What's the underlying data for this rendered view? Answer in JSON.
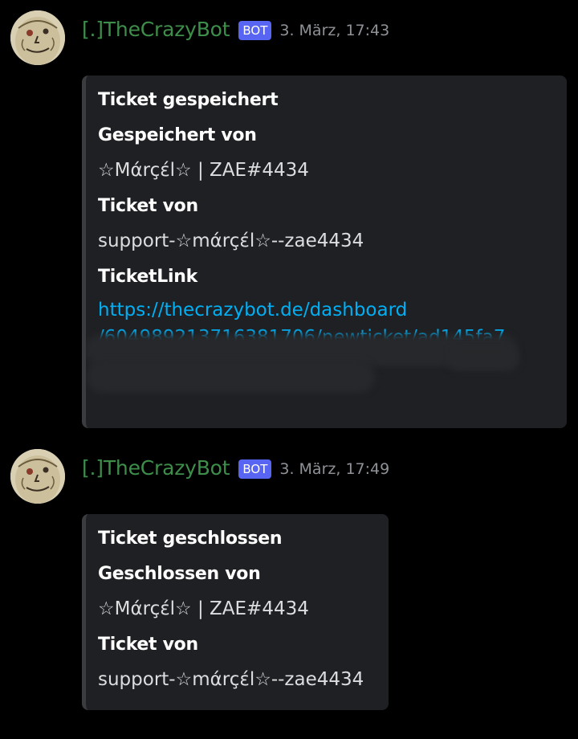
{
  "messages": [
    {
      "author": "[.]TheCrazyBot",
      "badge": "BOT",
      "timestamp": "3. März, 17:43",
      "embed": {
        "title": "Ticket gespeichert",
        "fields": [
          {
            "name": "Gespeichert von",
            "value": "☆Mάrçέl☆ | ZAE#4434"
          },
          {
            "name": "Ticket von",
            "value": "support-☆mάrçέl☆--zae4434"
          },
          {
            "name": "TicketLink",
            "value_lines": [
              "https://thecrazybot.de/dashboard",
              "/604989213716381706/newticket/ad145fa7"
            ]
          }
        ]
      }
    },
    {
      "author": "[.]TheCrazyBot",
      "badge": "BOT",
      "timestamp": "3. März, 17:49",
      "embed": {
        "title": "Ticket geschlossen",
        "fields": [
          {
            "name": "Geschlossen von",
            "value": "☆Mάrçέl☆ | ZAE#4434"
          },
          {
            "name": "Ticket von",
            "value": "support-☆mάrçέl☆--zae4434"
          }
        ]
      }
    }
  ],
  "colors": {
    "background": "#000000",
    "username": "#3e8e4b",
    "bot_badge": "#5865f2",
    "embed_bg": "#1f2023",
    "link": "#00aff4"
  },
  "icons": {
    "avatar": "hand-drawn-face-avatar"
  }
}
